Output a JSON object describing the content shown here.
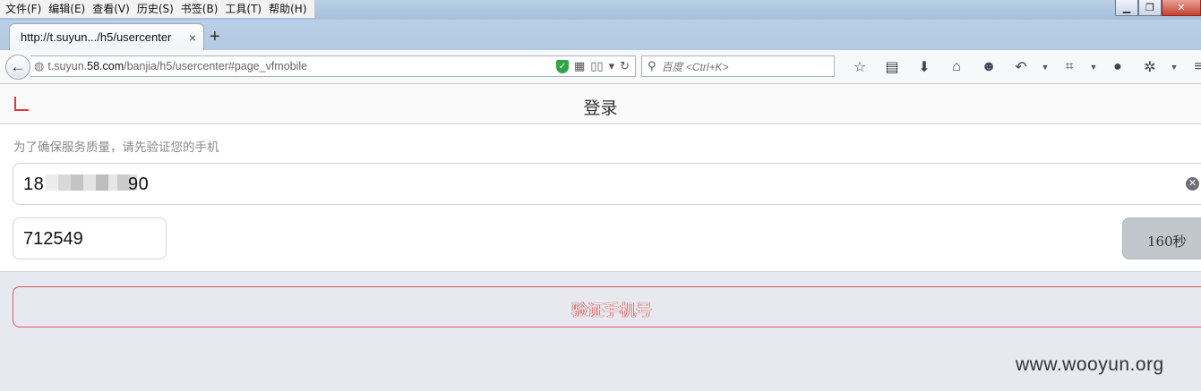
{
  "menu": [
    "文件(F)",
    "编辑(E)",
    "查看(V)",
    "历史(S)",
    "书签(B)",
    "工具(T)",
    "帮助(H)"
  ],
  "tab": {
    "title": "http://t.suyun.../h5/usercenter",
    "close": "×",
    "new_tab": "+"
  },
  "address": {
    "url_prefix": "t.suyun.",
    "url_domain": "58.com",
    "url_suffix": "/banjia/h5/usercenter#page_vfmobile",
    "search_placeholder": "百度 <Ctrl+K>"
  },
  "page": {
    "title": "登录",
    "hint": "为了确保服务质量，请先验证您的手机",
    "phone_value_start": "18",
    "phone_value_end": "90",
    "code_value": "712549",
    "countdown": "160秒",
    "verify_button": "验证手机号"
  },
  "watermark": "www.wooyun.org",
  "colors": {
    "accent": "#e03a3a",
    "page_bg": "#e6e9f0",
    "countdown_bg": "#c1c6cc"
  }
}
